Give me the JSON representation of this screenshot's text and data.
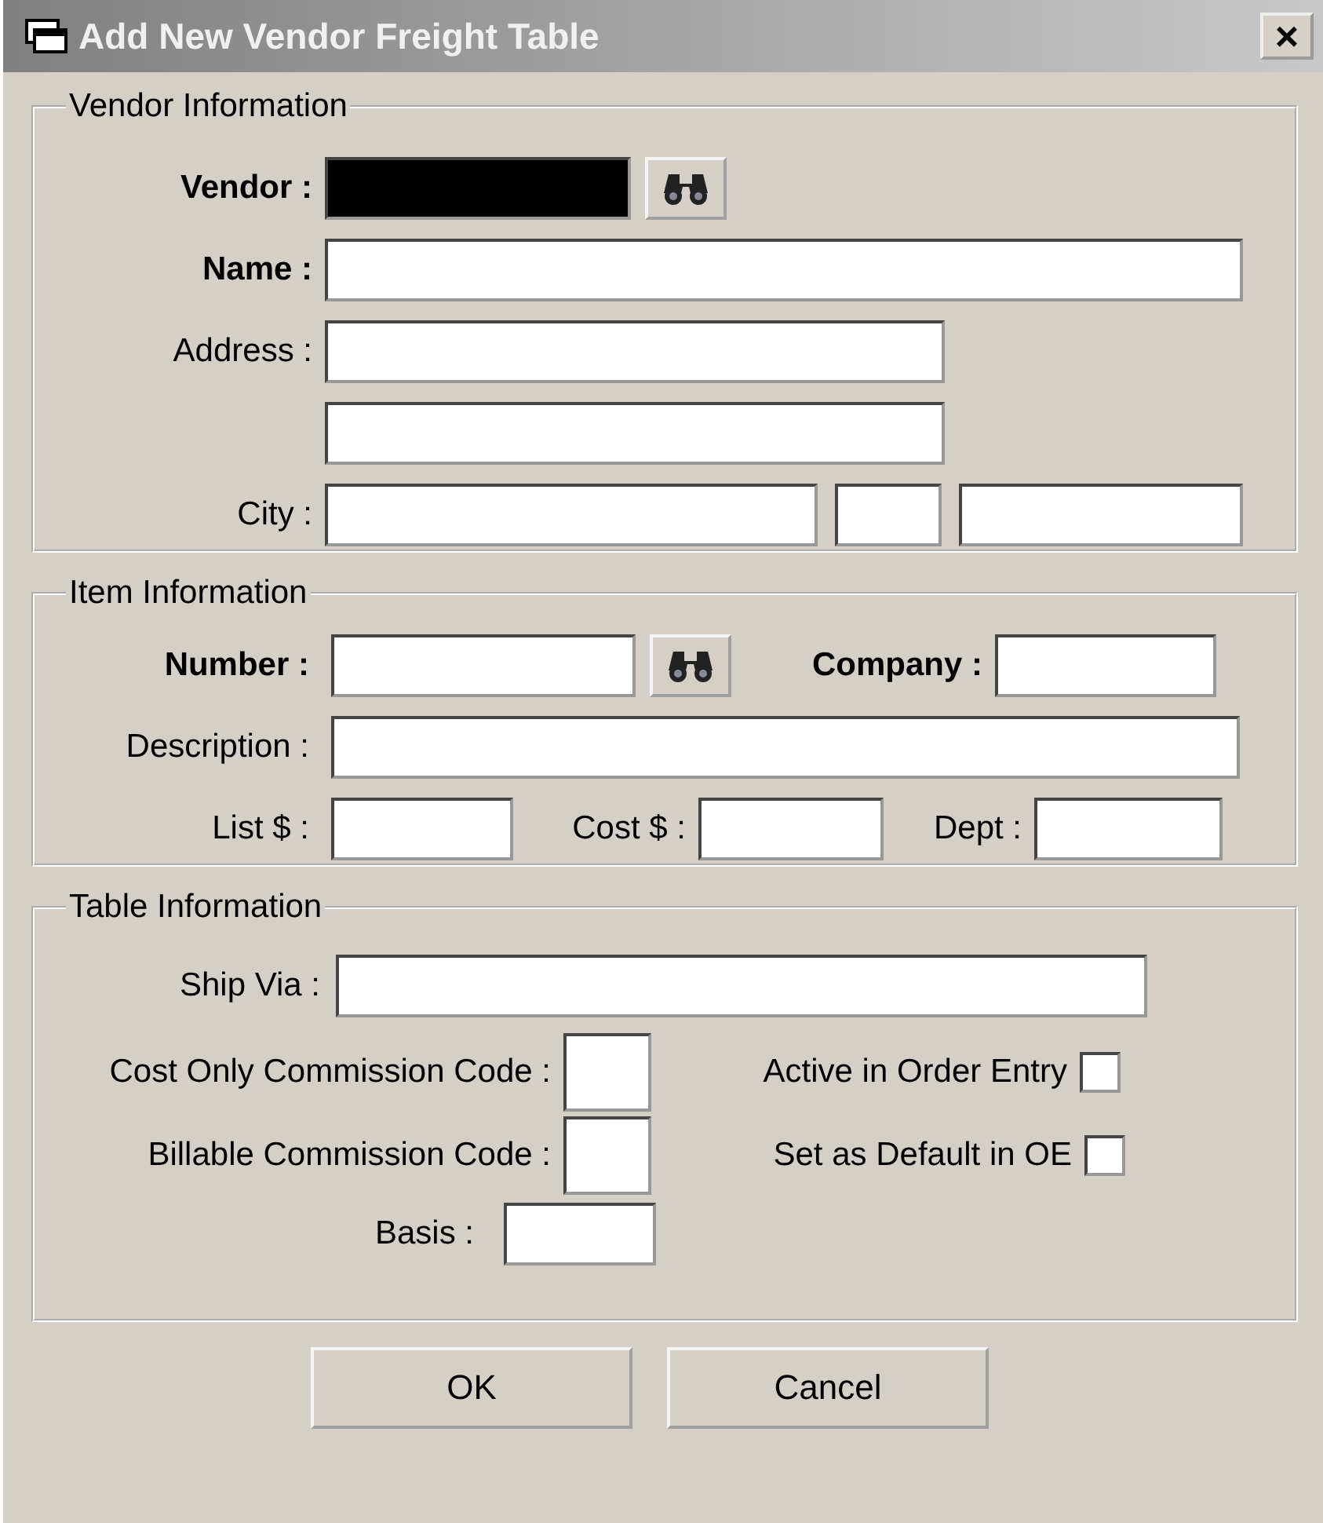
{
  "window": {
    "title": "Add New Vendor Freight Table",
    "close": "×"
  },
  "vendor_section": {
    "legend": "Vendor Information",
    "vendor": {
      "label": "Vendor :",
      "redacted": true
    },
    "name": {
      "label": "Name :"
    },
    "address": {
      "label": "Address :"
    },
    "city": {
      "label": "City :"
    }
  },
  "item_section": {
    "legend": "Item Information",
    "number": {
      "label": "Number :"
    },
    "company": {
      "label": "Company :"
    },
    "description": {
      "label": "Description :"
    },
    "list": {
      "label": "List $ :"
    },
    "cost": {
      "label": "Cost $ :"
    },
    "dept": {
      "label": "Dept :"
    }
  },
  "table_section": {
    "legend": "Table Information",
    "ship_via": {
      "label": "Ship Via :"
    },
    "cost_only_commission_code": {
      "label": "Cost Only Commission Code :"
    },
    "active_in_order_entry": {
      "label": "Active in Order Entry",
      "checked": false
    },
    "billable_commission_code": {
      "label": "Billable Commission Code :"
    },
    "set_as_default_in_oe": {
      "label": "Set as Default in OE",
      "checked": false
    },
    "basis": {
      "label": "Basis :"
    }
  },
  "buttons": [
    {
      "label": "OK"
    },
    {
      "label": "Cancel"
    }
  ]
}
